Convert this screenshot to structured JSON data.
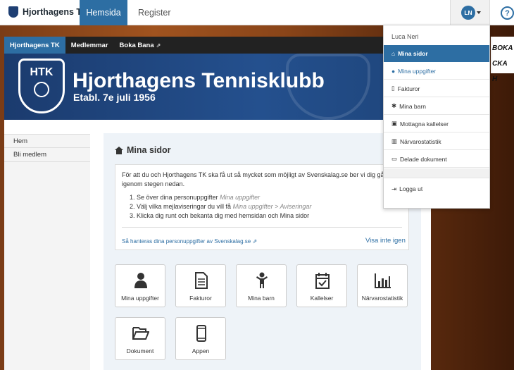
{
  "topbar": {
    "brand": "Hjorthagens TK",
    "nav": [
      {
        "label": "Hemsida",
        "active": true
      },
      {
        "label": "Register",
        "active": false
      }
    ],
    "avatar_initials": "LN",
    "help_glyph": "?"
  },
  "subnav": {
    "items": [
      "Hjorthagens TK",
      "Medlemmar",
      "Boka Bana"
    ],
    "external_glyph": "⇗"
  },
  "banner": {
    "emblem_text": "HTK",
    "title": "Hjorthagens Tennisklubb",
    "subtitle": "Etabl. 7e juli 1956"
  },
  "sidebar": {
    "items": [
      "Hem",
      "Bli medlem"
    ]
  },
  "main": {
    "title": "Mina sidor",
    "intro": "För att du och Hjorthagens TK ska få ut så mycket som möjligt av Svenskalag.se ber vi dig gå igenom stegen nedan.",
    "steps": [
      {
        "text": "Se över dina personuppgifter ",
        "hint": "Mina uppgifter"
      },
      {
        "text": "Välj vilka mejlaviseringar du vill få ",
        "hint": "Mina uppgifter > Aviseringar"
      },
      {
        "text": "Klicka dig runt och bekanta dig med hemsidan och Mina sidor",
        "hint": ""
      }
    ],
    "privacy_link": "Så hanteras dina personuppgifter av Svenskalag.se",
    "hide_label": "Visa inte igen",
    "tiles": [
      "Mina uppgifter",
      "Fakturor",
      "Mina barn",
      "Kallelser",
      "Närvarostatistik",
      "Dokument",
      "Appen"
    ]
  },
  "dropdown": {
    "user": "Luca Neri",
    "items": [
      "Mina sidor",
      "Mina uppgifter",
      "Fakturor",
      "Mina barn",
      "Mottagna kallelser",
      "Närvarostatistik",
      "Delade dokument"
    ],
    "logout": "Logga ut"
  },
  "background_text": [
    "BOKA",
    "CKA H"
  ],
  "colors": {
    "accent": "#2d6ea3",
    "banner": "#1b3b6e",
    "topbar": "#ffffff"
  }
}
